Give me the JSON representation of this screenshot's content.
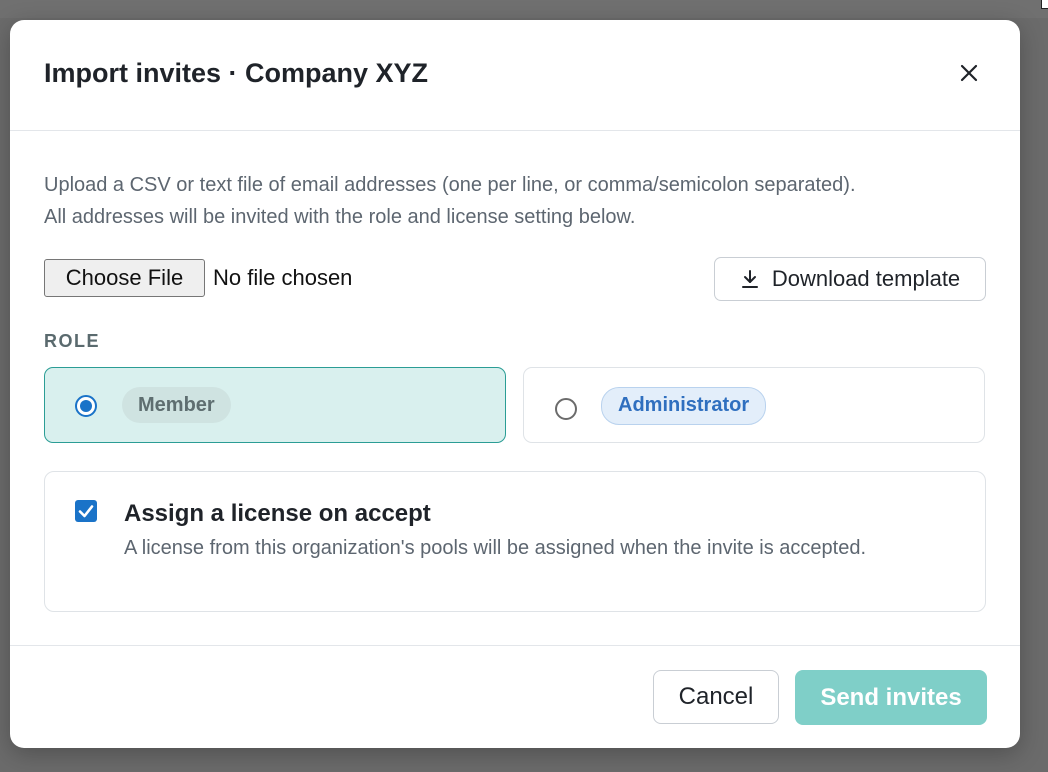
{
  "modal": {
    "title": "Import invites · Company XYZ",
    "close_icon": "close-icon"
  },
  "body": {
    "description_line1": "Upload a CSV or text file of email addresses (one per line, or comma/semicolon separated).",
    "description_line2": "All addresses will be invited with the role and license setting below.",
    "file_input": {
      "button_label": "Choose File",
      "status": "No file chosen"
    },
    "download_template": {
      "label": "Download template",
      "icon": "download-icon"
    },
    "role_section_label": "ROLE",
    "roles": [
      {
        "label": "Member",
        "selected": true
      },
      {
        "label": "Administrator",
        "selected": false
      }
    ],
    "license": {
      "checked": true,
      "title": "Assign a license on accept",
      "description": "A license from this organization's pools will be assigned when the invite is accepted."
    }
  },
  "footer": {
    "cancel_label": "Cancel",
    "send_label": "Send invites"
  },
  "colors": {
    "accent": "#1a73c8",
    "selected_card_bg": "#d9f0ee",
    "selected_card_border": "#2b9d95",
    "send_button_disabled": "#7fcfc8"
  }
}
